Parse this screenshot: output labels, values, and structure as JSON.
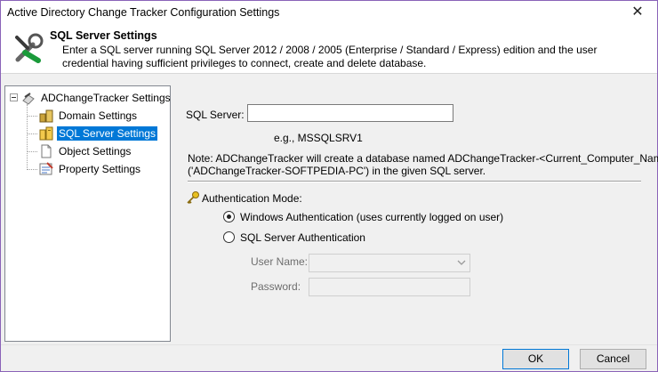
{
  "window": {
    "title": "Active Directory Change Tracker Configuration Settings",
    "close_glyph": "✕"
  },
  "header": {
    "icon": "tools-icon",
    "title": "SQL Server Settings",
    "description": "Enter a SQL server running SQL Server 2012 / 2008 / 2005 (Enterprise / Standard / Express) edition and the user credential having sufficient privileges to connect, create and delete database."
  },
  "tree": {
    "root": {
      "label": "ADChangeTracker Settings",
      "icon": "settings-root-icon"
    },
    "items": [
      {
        "label": "Domain Settings",
        "icon": "domain-icon"
      },
      {
        "label": "SQL Server Settings",
        "icon": "sql-server-icon",
        "selected": true
      },
      {
        "label": "Object Settings",
        "icon": "document-icon"
      },
      {
        "label": "Property Settings",
        "icon": "property-icon"
      }
    ]
  },
  "form": {
    "sql_server_label": "SQL Server:",
    "sql_server_value": "",
    "example": "e.g., MSSQLSRV1",
    "note_line1": "Note: ADChangeTracker will create a database named ADChangeTracker-<Current_Computer_Name>",
    "note_line2": "('ADChangeTracker-SOFTPEDIA-PC') in the given SQL server.",
    "auth_label": "Authentication Mode:",
    "auth_options": [
      {
        "label": "Windows Authentication (uses currently logged on user)",
        "checked": true
      },
      {
        "label": "SQL Server Authentication",
        "checked": false
      }
    ],
    "username_label": "User Name:",
    "username_value": "",
    "password_label": "Password:",
    "password_value": ""
  },
  "buttons": {
    "ok": "OK",
    "cancel": "Cancel"
  },
  "colors": {
    "selection": "#0078d7",
    "window_border": "#8a63b8"
  }
}
